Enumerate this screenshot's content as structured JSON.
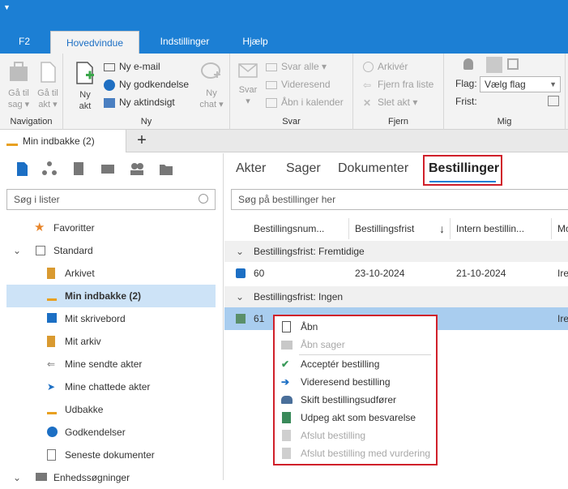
{
  "menu": {
    "tabs": [
      "F2",
      "Hovedvindue",
      "Indstillinger",
      "Hjælp"
    ],
    "active": "Hovedvindue"
  },
  "ribbon": {
    "navigation": {
      "label": "Navigation",
      "back": [
        "Gå til",
        "sag ▾"
      ],
      "forward": [
        "Gå til",
        "akt ▾"
      ]
    },
    "ny": {
      "label": "Ny",
      "big": [
        "Ny",
        "akt"
      ],
      "items": [
        "Ny e-mail",
        "Ny godkendelse",
        "Ny aktindsigt"
      ],
      "chat": [
        "Ny",
        "chat ▾"
      ]
    },
    "svar": {
      "label": "Svar",
      "big": [
        "Svar",
        "▾"
      ],
      "items": [
        "Svar alle ▾",
        "Videresend",
        "Åbn i kalender"
      ]
    },
    "fjern": {
      "label": "Fjern",
      "items": [
        "Arkivér",
        "Fjern fra liste",
        "Slet akt ▾"
      ]
    },
    "mig": {
      "label": "Mig",
      "flag_label": "Flag:",
      "flag_value": "Vælg flag",
      "frist_label": "Frist:"
    }
  },
  "doctab": {
    "label": "Min indbakke (2)",
    "add": "+"
  },
  "left": {
    "search_placeholder": "Søg i lister",
    "items": [
      {
        "label": "Favoritter"
      },
      {
        "label": "Standard"
      },
      {
        "label": "Arkivet"
      },
      {
        "label": "Min indbakke (2)"
      },
      {
        "label": "Mit skrivebord"
      },
      {
        "label": "Mit arkiv"
      },
      {
        "label": "Mine sendte akter"
      },
      {
        "label": "Mine chattede akter"
      },
      {
        "label": "Udbakke"
      },
      {
        "label": "Godkendelser"
      },
      {
        "label": "Seneste dokumenter"
      },
      {
        "label": "Enhedssøgninger"
      }
    ]
  },
  "right": {
    "tabs": [
      "Akter",
      "Sager",
      "Dokumenter",
      "Bestillinger"
    ],
    "active_tab": "Bestillinger",
    "search_placeholder": "Søg på bestillinger her",
    "columns": [
      "Bestillingsnum...",
      "Bestillingsfrist",
      "Intern bestillin...",
      "Mo"
    ],
    "sort_arrow": "↓",
    "groups": [
      {
        "label": "Bestillingsfrist: Fremtidige",
        "rows": [
          {
            "num": "60",
            "frist": "23-10-2024",
            "intern": "21-10-2024",
            "mo": "Ire"
          }
        ]
      },
      {
        "label": "Bestillingsfrist: Ingen",
        "rows": [
          {
            "num": "61",
            "frist": "",
            "intern": "",
            "mo": "Ire"
          }
        ]
      }
    ]
  },
  "context_menu": {
    "items": [
      {
        "label": "Åbn",
        "disabled": false
      },
      {
        "label": "Åbn sager",
        "disabled": true
      },
      {
        "label": "Acceptér bestilling",
        "disabled": false
      },
      {
        "label": "Videresend bestilling",
        "disabled": false
      },
      {
        "label": "Skift bestillingsudfører",
        "disabled": false
      },
      {
        "label": "Udpeg akt som besvarelse",
        "disabled": false
      },
      {
        "label": "Afslut bestilling",
        "disabled": true
      },
      {
        "label": "Afslut bestilling med vurdering",
        "disabled": true
      }
    ]
  },
  "colors": {
    "accent": "#1c7fd4",
    "highlight": "#d0202a",
    "selection": "#cde3f7"
  }
}
